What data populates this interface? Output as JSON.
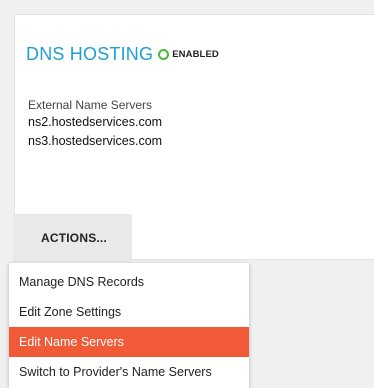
{
  "dns": {
    "title": "DNS HOSTING",
    "status": "ENABLED",
    "status_color": "#49b83e",
    "title_color": "#1f9fd4",
    "name_servers_label": "External Name Servers",
    "name_servers": [
      "ns2.hostedservices.com",
      "ns3.hostedservices.com"
    ]
  },
  "actions": {
    "label": "ACTIONS...",
    "menu": [
      {
        "label": "Manage DNS Records"
      },
      {
        "label": "Edit Zone Settings"
      },
      {
        "label": "Edit Name Servers",
        "active": true
      },
      {
        "label": "Switch to Provider's Name Servers"
      }
    ],
    "active_color": "#f05a36"
  }
}
